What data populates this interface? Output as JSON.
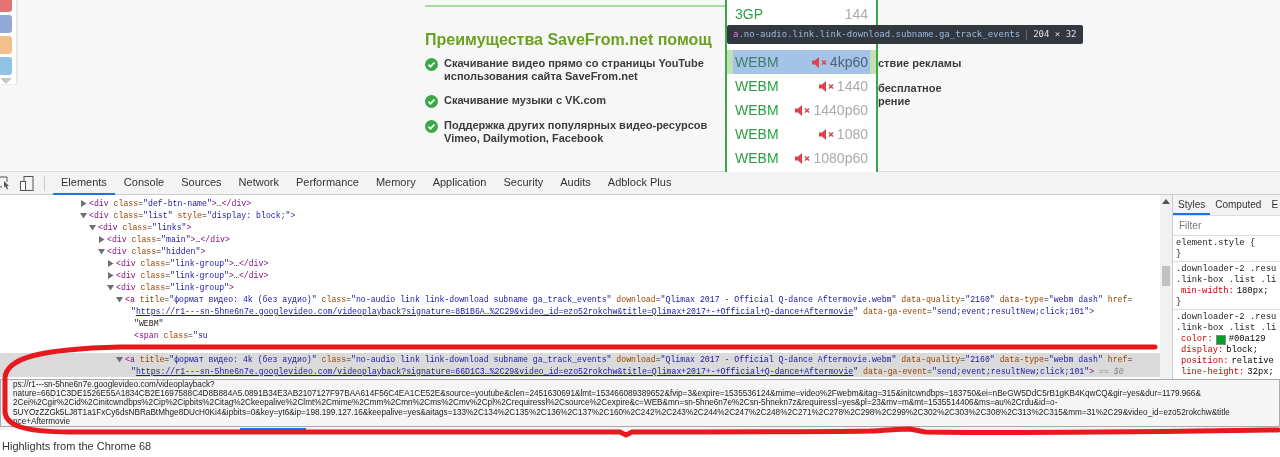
{
  "page": {
    "share_buttons": [
      {
        "color": "#e57373"
      },
      {
        "color": "#8fa8d6"
      },
      {
        "color": "#f3c08c"
      },
      {
        "color": "#91c3e6"
      }
    ],
    "heading": "Преимущества SaveFrom.net помощ",
    "left_features": [
      {
        "lines": [
          "Скачивание видео прямо со страницы YouTube",
          "использования сайта SaveFrom.net"
        ]
      },
      {
        "lines": [
          "Скачивание музыки с VK.com"
        ]
      },
      {
        "lines": [
          "Поддержка других популярных видео-ресурсов",
          "Vimeo, Dailymotion, Facebook"
        ]
      }
    ],
    "right_features": [
      {
        "lines": [
          "ствие рекламы"
        ]
      },
      {
        "lines": [
          "бесплатное",
          "рение"
        ]
      }
    ],
    "download_list": [
      {
        "format": "3GP",
        "quality": "144",
        "no_audio": false,
        "selected": false
      },
      {
        "format": "WEBM",
        "quality": "4kp60",
        "no_audio": true,
        "selected": true
      },
      {
        "format": "WEBM",
        "quality": "1440",
        "no_audio": true,
        "selected": false
      },
      {
        "format": "WEBM",
        "quality": "1440p60",
        "no_audio": true,
        "selected": false
      },
      {
        "format": "WEBM",
        "quality": "1080",
        "no_audio": true,
        "selected": false
      },
      {
        "format": "WEBM",
        "quality": "1080p60",
        "no_audio": true,
        "selected": false
      }
    ],
    "element_tooltip": {
      "tag": "a",
      "classes": ".no-audio.link.link-download.subname.ga_track_events",
      "size": "204 × 32"
    }
  },
  "devtools": {
    "tabs": [
      {
        "label": "Elements",
        "selected": true
      },
      {
        "label": "Console",
        "selected": false
      },
      {
        "label": "Sources",
        "selected": false
      },
      {
        "label": "Network",
        "selected": false
      },
      {
        "label": "Performance",
        "selected": false
      },
      {
        "label": "Memory",
        "selected": false
      },
      {
        "label": "Application",
        "selected": false
      },
      {
        "label": "Security",
        "selected": false
      },
      {
        "label": "Audits",
        "selected": false
      },
      {
        "label": "Adblock Plus",
        "selected": false
      }
    ],
    "dom_tree": [
      {
        "kind": "node",
        "expanded": false,
        "selected": false,
        "lines": [
          [
            {
              "kind": "tag",
              "text": "<div"
            },
            {
              "kind": "attr",
              "text": " class"
            },
            {
              "kind": "punct",
              "text": "="
            },
            {
              "kind": "val",
              "text": "\"def-btn-name\""
            },
            {
              "kind": "tag",
              "text": ">"
            },
            {
              "kind": "punct",
              "text": "…"
            },
            {
              "kind": "tag",
              "text": "</div>"
            }
          ]
        ]
      },
      {
        "kind": "node",
        "expanded": true,
        "selected": false,
        "lines": [
          [
            {
              "kind": "tag",
              "text": "<div"
            },
            {
              "kind": "attr",
              "text": " class"
            },
            {
              "kind": "punct",
              "text": "="
            },
            {
              "kind": "val",
              "text": "\"list\""
            },
            {
              "kind": "attr",
              "text": " style"
            },
            {
              "kind": "punct",
              "text": "="
            },
            {
              "kind": "val",
              "text": "\"display: block;\""
            },
            {
              "kind": "tag",
              "text": ">"
            }
          ]
        ],
        "children": [
          {
            "kind": "node",
            "expanded": true,
            "selected": false,
            "lines": [
              [
                {
                  "kind": "tag",
                  "text": "<div"
                },
                {
                  "kind": "attr",
                  "text": " class"
                },
                {
                  "kind": "punct",
                  "text": "="
                },
                {
                  "kind": "val",
                  "text": "\"links\""
                },
                {
                  "kind": "tag",
                  "text": ">"
                }
              ]
            ],
            "children": [
              {
                "kind": "node",
                "expanded": false,
                "selected": false,
                "lines": [
                  [
                    {
                      "kind": "tag",
                      "text": "<div"
                    },
                    {
                      "kind": "attr",
                      "text": " class"
                    },
                    {
                      "kind": "punct",
                      "text": "="
                    },
                    {
                      "kind": "val",
                      "text": "\"main\""
                    },
                    {
                      "kind": "tag",
                      "text": ">"
                    },
                    {
                      "kind": "punct",
                      "text": "…"
                    },
                    {
                      "kind": "tag",
                      "text": "</div>"
                    }
                  ]
                ]
              },
              {
                "kind": "node",
                "expanded": true,
                "selected": false,
                "lines": [
                  [
                    {
                      "kind": "tag",
                      "text": "<div"
                    },
                    {
                      "kind": "attr",
                      "text": " class"
                    },
                    {
                      "kind": "punct",
                      "text": "="
                    },
                    {
                      "kind": "val",
                      "text": "\"hidden\""
                    },
                    {
                      "kind": "tag",
                      "text": ">"
                    }
                  ]
                ],
                "children": [
                  {
                    "kind": "node",
                    "expanded": false,
                    "selected": false,
                    "lines": [
                      [
                        {
                          "kind": "tag",
                          "text": "<div"
                        },
                        {
                          "kind": "attr",
                          "text": " class"
                        },
                        {
                          "kind": "punct",
                          "text": "="
                        },
                        {
                          "kind": "val",
                          "text": "\"link-group\""
                        },
                        {
                          "kind": "tag",
                          "text": ">"
                        },
                        {
                          "kind": "punct",
                          "text": "…"
                        },
                        {
                          "kind": "tag",
                          "text": "</div>"
                        }
                      ]
                    ]
                  },
                  {
                    "kind": "node",
                    "expanded": false,
                    "selected": false,
                    "lines": [
                      [
                        {
                          "kind": "tag",
                          "text": "<div"
                        },
                        {
                          "kind": "attr",
                          "text": " class"
                        },
                        {
                          "kind": "punct",
                          "text": "="
                        },
                        {
                          "kind": "val",
                          "text": "\"link-group\""
                        },
                        {
                          "kind": "tag",
                          "text": ">"
                        },
                        {
                          "kind": "punct",
                          "text": "…"
                        },
                        {
                          "kind": "tag",
                          "text": "</div>"
                        }
                      ]
                    ]
                  },
                  {
                    "kind": "node",
                    "expanded": true,
                    "selected": false,
                    "lines": [
                      [
                        {
                          "kind": "tag",
                          "text": "<div"
                        },
                        {
                          "kind": "attr",
                          "text": " class"
                        },
                        {
                          "kind": "punct",
                          "text": "="
                        },
                        {
                          "kind": "val",
                          "text": "\"link-group\""
                        },
                        {
                          "kind": "tag",
                          "text": ">"
                        }
                      ]
                    ],
                    "children": [
                      {
                        "kind": "node",
                        "expanded": true,
                        "selected": false,
                        "lines": [
                          [
                            {
                              "kind": "tag",
                              "text": "<a"
                            },
                            {
                              "kind": "attr",
                              "text": " title"
                            },
                            {
                              "kind": "punct",
                              "text": "="
                            },
                            {
                              "kind": "val",
                              "text": "\"формат видео: 4k (без аудио)\""
                            },
                            {
                              "kind": "attr",
                              "text": " class"
                            },
                            {
                              "kind": "punct",
                              "text": "="
                            },
                            {
                              "kind": "val",
                              "text": "\"no-audio link link-download subname ga_track_events\""
                            },
                            {
                              "kind": "attr",
                              "text": " download"
                            },
                            {
                              "kind": "punct",
                              "text": "="
                            },
                            {
                              "kind": "val",
                              "text": "\"Qlimax 2017 - Official Q-dance Aftermovie.webm\""
                            },
                            {
                              "kind": "attr",
                              "text": " data-quality"
                            },
                            {
                              "kind": "punct",
                              "text": "="
                            },
                            {
                              "kind": "val",
                              "text": "\"2160\""
                            },
                            {
                              "kind": "attr",
                              "text": " data-type"
                            },
                            {
                              "kind": "punct",
                              "text": "="
                            },
                            {
                              "kind": "val",
                              "text": "\"webm dash\""
                            },
                            {
                              "kind": "attr",
                              "text": " href"
                            },
                            {
                              "kind": "punct",
                              "text": "="
                            }
                          ],
                          [
                            {
                              "kind": "val",
                              "text": "\""
                            },
                            {
                              "kind": "link",
                              "text": "https://r1---sn-5hne6n7e.googlevideo.com/videoplayback?signature=8B1B6A…%2C29&video_id=ezo52rokchw&title=Qlimax+2017+-+Official+Q-dance+Aftermovie"
                            },
                            {
                              "kind": "val",
                              "text": "\""
                            },
                            {
                              "kind": "attr",
                              "text": " data-ga-event"
                            },
                            {
                              "kind": "punct",
                              "text": "="
                            },
                            {
                              "kind": "val",
                              "text": "\"send;event;resultNew;click;101\""
                            },
                            {
                              "kind": "tag",
                              "text": ">"
                            }
                          ]
                        ],
                        "children": [
                          {
                            "kind": "text",
                            "selected": false,
                            "lines": [
                              [
                                {
                                  "kind": "punct",
                                  "text": "\"WEBM\""
                                }
                              ]
                            ]
                          },
                          {
                            "kind": "text",
                            "selected": false,
                            "lines": [
                              [
                                {
                                  "kind": "tag",
                                  "text": "<span"
                                },
                                {
                                  "kind": "attr",
                                  "text": " class"
                                },
                                {
                                  "kind": "punct",
                                  "text": "="
                                },
                                {
                                  "kind": "val",
                                  "text": "\"su"
                                }
                              ]
                            ]
                          }
                        ]
                      },
                      {
                        "kind": "node",
                        "expanded": true,
                        "selected": true,
                        "lines": [
                          [
                            {
                              "kind": "tag",
                              "text": "<a"
                            },
                            {
                              "kind": "attr",
                              "text": " title"
                            },
                            {
                              "kind": "punct",
                              "text": "="
                            },
                            {
                              "kind": "val",
                              "text": "\"формат видео: 4k (без аудио)\""
                            },
                            {
                              "kind": "attr",
                              "text": " class"
                            },
                            {
                              "kind": "punct",
                              "text": "="
                            },
                            {
                              "kind": "val",
                              "text": "\"no-audio link link-download subname ga_track_events\""
                            },
                            {
                              "kind": "attr",
                              "text": " download"
                            },
                            {
                              "kind": "punct",
                              "text": "="
                            },
                            {
                              "kind": "val",
                              "text": "\"Qlimax 2017 - Official Q-dance Aftermovie.webm\""
                            },
                            {
                              "kind": "attr",
                              "text": " data-quality"
                            },
                            {
                              "kind": "punct",
                              "text": "="
                            },
                            {
                              "kind": "val",
                              "text": "\"2160\""
                            },
                            {
                              "kind": "attr",
                              "text": " data-type"
                            },
                            {
                              "kind": "punct",
                              "text": "="
                            },
                            {
                              "kind": "val",
                              "text": "\"webm dash\""
                            },
                            {
                              "kind": "attr",
                              "text": " href"
                            },
                            {
                              "kind": "punct",
                              "text": "="
                            }
                          ],
                          [
                            {
                              "kind": "val",
                              "text": "\""
                            },
                            {
                              "kind": "link",
                              "text": "https://r1---sn-5hne6n7e.googlevideo.com/videoplayback?signature=66D1C3…%2C29&video_id=ezo52rokchw&title=Qlimax+2017+-+Official+Q-dance+Aftermovie"
                            },
                            {
                              "kind": "val",
                              "text": "\""
                            },
                            {
                              "kind": "attr",
                              "text": " data-ga-event"
                            },
                            {
                              "kind": "punct",
                              "text": "="
                            },
                            {
                              "kind": "val",
                              "text": "\"send;event;resultNew;click;101\""
                            },
                            {
                              "kind": "tag",
                              "text": ">"
                            },
                            {
                              "kind": "comment",
                              "text": " == $0"
                            }
                          ]
                        ]
                      }
                    ]
                  }
                ]
              }
            ]
          }
        ]
      }
    ],
    "link_tooltip": [
      "ps://r1---sn-5hne6n7e.googlevideo.com/videoplayback?",
      "nature=66D1C3DE1526E55A1834CB2E1697588C4D8B884A5.0891B34E3AB2107127F97BAA614F56C4EA1CE52E&source=youtube&clen=2451630691&lmt=153466089389652&fvip=3&expire=1535536124&mime=video%2Fwebm&itag=315&initcwndbps=183750&ei=nBeGW5DdC5rB1gKB4KqwCQ&gir=yes&dur=1179.966&",
      "2Cei%2Cgir%2Cid%2Cinitcwndbps%2Cip%2Cipbits%2Citag%2Ckeepalive%2Clmt%2Cmime%2Cmm%2Cmn%2Cms%2Cmv%2Cpl%2Crequiressl%2Csource%2Cexpire&c=WEB&mn=sn-5hne6n7e%2Csn-5hnekn7z&requiressl=yes&pl=23&mv=m&mt=1535514406&ms=au%2Crdu&id=o-",
      "5UYOzZZGk5LJ8T1a1FxCy6dsNBRaBtMhge8DUcH0Ki4&ipbits=0&key=yt6&ip=198.199.127.16&keepalive=yes&aitags=133%2C134%2C135%2C136%2C137%2C160%2C242%2C243%2C244%2C247%2C248%2C271%2C278%2C298%2C299%2C302%2C303%2C308%2C313%2C315&mm=31%2C29&video_id=ezo52rokchw&title",
      "nce+Aftermovie"
    ],
    "side_tabs": [
      {
        "label": "Styles",
        "selected": true
      },
      {
        "label": "Computed",
        "selected": false
      },
      {
        "label": "E",
        "selected": false
      }
    ],
    "filter": {
      "placeholder": "Filter"
    },
    "style_rules": [
      {
        "selector_lines": [
          "element.style {"
        ],
        "close": "}"
      },
      {
        "selector_lines": [
          ".downloader-2 .resu",
          ".link-box .list .li"
        ],
        "declarations": [
          {
            "prop": "min-width:",
            "value": "180px;"
          }
        ],
        "close": "}"
      },
      {
        "selector_lines": [
          ".downloader-2 .resu",
          ".link-box .list .li"
        ],
        "declarations": [
          {
            "prop": "color:",
            "value": "#00a129",
            "swatch": true
          },
          {
            "prop": "display:",
            "value": "block;"
          },
          {
            "prop": "position:",
            "value": "relative"
          },
          {
            "prop": "line-height:",
            "value": "32px;"
          }
        ]
      }
    ],
    "drawer_text": "Highlights from the Chrome 68"
  }
}
